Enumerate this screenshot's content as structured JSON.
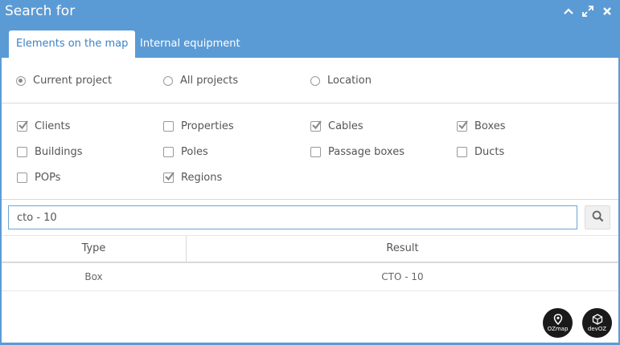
{
  "dialog": {
    "title": "Search for"
  },
  "tabs": [
    {
      "label": "Elements on the map",
      "active": true
    },
    {
      "label": "Internal equipment",
      "active": false
    }
  ],
  "scope": {
    "options": [
      {
        "label": "Current project",
        "checked": true
      },
      {
        "label": "All projects",
        "checked": false
      },
      {
        "label": "Location",
        "checked": false
      }
    ]
  },
  "filters": [
    {
      "label": "Clients",
      "checked": true
    },
    {
      "label": "Properties",
      "checked": false
    },
    {
      "label": "Cables",
      "checked": true
    },
    {
      "label": "Boxes",
      "checked": true
    },
    {
      "label": "Buildings",
      "checked": false
    },
    {
      "label": "Poles",
      "checked": false
    },
    {
      "label": "Passage boxes",
      "checked": false
    },
    {
      "label": "Ducts",
      "checked": false
    },
    {
      "label": "POPs",
      "checked": false
    },
    {
      "label": "Regions",
      "checked": true
    }
  ],
  "search": {
    "value": "cto - 10"
  },
  "table": {
    "headers": {
      "type": "Type",
      "result": "Result"
    },
    "rows": [
      {
        "type": "Box",
        "result": "CTO - 10"
      }
    ]
  },
  "logos": {
    "ozmap": "OZmap",
    "devoz": "devOZ"
  },
  "colors": {
    "header_bg": "#5b9bd5",
    "accent": "#3b82c4"
  }
}
